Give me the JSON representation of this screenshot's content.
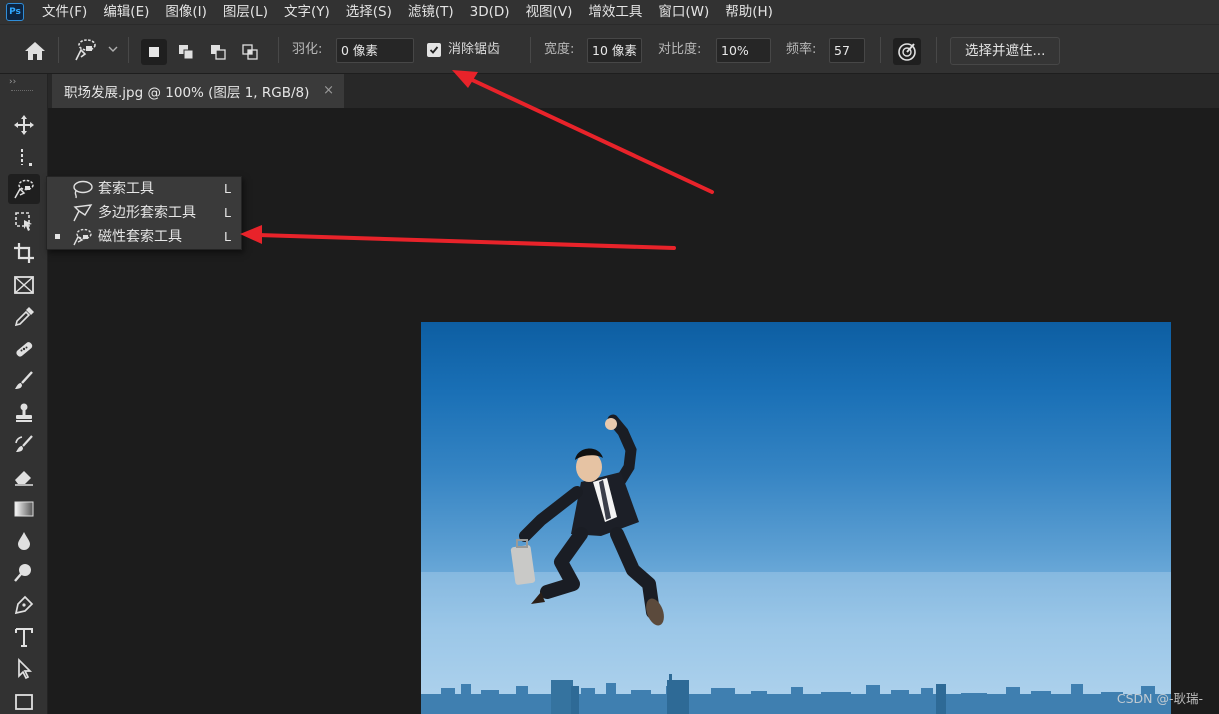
{
  "app": {
    "logo_text": "Ps"
  },
  "menu": [
    "文件(F)",
    "编辑(E)",
    "图像(I)",
    "图层(L)",
    "文字(Y)",
    "选择(S)",
    "滤镜(T)",
    "3D(D)",
    "视图(V)",
    "增效工具",
    "窗口(W)",
    "帮助(H)"
  ],
  "options": {
    "feather_label": "羽化:",
    "feather_value": "0 像素",
    "antialias_label": "消除锯齿",
    "antialias_checked": true,
    "width_label": "宽度:",
    "width_value": "10 像素",
    "contrast_label": "对比度:",
    "contrast_value": "10%",
    "frequency_label": "频率:",
    "frequency_value": "57",
    "select_mask_label": "选择并遮住..."
  },
  "toolbar": {
    "collapse_glyph": "››"
  },
  "document": {
    "tab_title": "职场发展.jpg @ 100% (图层 1, RGB/8)",
    "close_glyph": "×"
  },
  "flyout": {
    "items": [
      {
        "label": "套索工具",
        "shortcut": "L",
        "icon": "lasso-icon",
        "selected": false
      },
      {
        "label": "多边形套索工具",
        "shortcut": "L",
        "icon": "polygonal-lasso-icon",
        "selected": false
      },
      {
        "label": "磁性套索工具",
        "shortcut": "L",
        "icon": "magnetic-lasso-icon",
        "selected": true
      }
    ]
  },
  "watermark": "CSDN @-耿瑞-",
  "colors": {
    "annotation_arrow": "#e8232a",
    "panel_bg": "#323232",
    "canvas_bg": "#1c1c1c",
    "sky_top": "#0d5ea2",
    "sky_bottom": "#aad0ec"
  }
}
